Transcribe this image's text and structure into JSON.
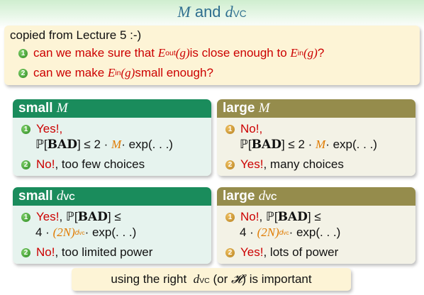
{
  "title": {
    "var": "M",
    "and": "and",
    "dvc_d": "d",
    "dvc_sub": "VC"
  },
  "intro": {
    "copied": "copied from Lecture 5 :-)",
    "q1": {
      "num": "1",
      "pre": "can we make sure that ",
      "eout": "E",
      "eout_sub": "out",
      "g1": "(g)",
      "mid": " is close enough to ",
      "ein": "E",
      "ein_sub": "in",
      "g2": "(g)",
      "end": "?"
    },
    "q2": {
      "num": "2",
      "pre": "can we make ",
      "ein": "E",
      "ein_sub": "in",
      "g": "(g)",
      "end": " small enough?"
    }
  },
  "small_m": {
    "header": "small",
    "header_var": "M",
    "i1_num": "1",
    "i1_yes": "Yes!,",
    "i1_p": "ℙ[",
    "i1_bad": "BAD",
    "i1_rest": "] ≤ 2 · ",
    "i1_m": "M",
    "i1_exp": " · exp(. . .)",
    "i2_num": "2",
    "i2_ans": "No!",
    "i2_text": ", too few choices"
  },
  "large_m": {
    "header": "large",
    "header_var": "M",
    "i1_num": "1",
    "i1_ans": "No!,",
    "i1_p": "ℙ[",
    "i1_bad": "BAD",
    "i1_rest": "] ≤ 2 · ",
    "i1_m": "M",
    "i1_exp": " · exp(. . .)",
    "i2_num": "2",
    "i2_ans": "Yes!",
    "i2_text": ", many choices"
  },
  "small_dvc": {
    "header": "small",
    "header_d": "d",
    "header_sub": "VC",
    "i1_num": "1",
    "i1_ans": "Yes!",
    "i1_p": ", ℙ[",
    "i1_bad": "BAD",
    "i1_rest": "] ≤",
    "l2_pre": "4 · ",
    "l2_2n": "(2N)",
    "l2_sup_d": "d",
    "l2_sup_sub": "vc",
    "l2_exp": " · exp(. . .)",
    "i2_num": "2",
    "i2_ans": "No!",
    "i2_text": ", too limited power"
  },
  "large_dvc": {
    "header": "large",
    "header_d": "d",
    "header_sub": "VC",
    "i1_num": "1",
    "i1_ans": "No!",
    "i1_p": ", ℙ[",
    "i1_bad": "BAD",
    "i1_rest": "] ≤",
    "l2_pre": "4 · ",
    "l2_2n": "(2N)",
    "l2_sup_d": "d",
    "l2_sup_sub": "vc",
    "l2_exp": " · exp(. . .)",
    "i2_num": "2",
    "i2_ans": "Yes!",
    "i2_text": ", lots of power"
  },
  "conclusion": {
    "pre": "using the right ",
    "d": "d",
    "sub": "VC",
    "mid": " (or ",
    "h": "𝓗",
    "end": ") is important"
  }
}
